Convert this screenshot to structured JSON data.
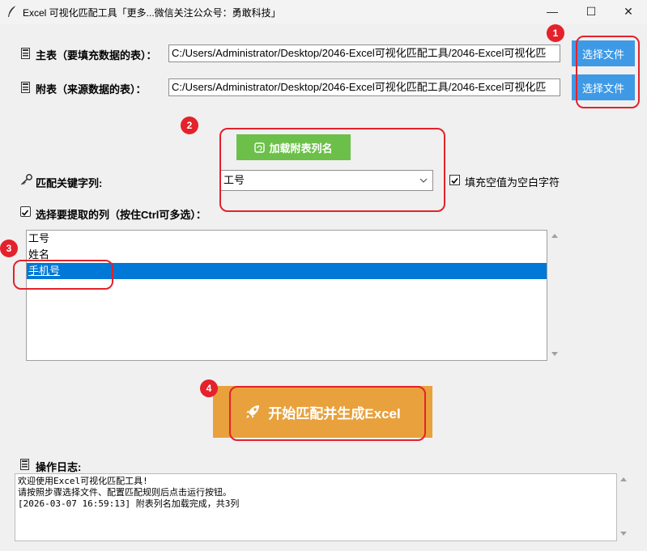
{
  "window": {
    "title": "Excel 可视化匹配工具「更多...微信关注公众号：勇敢科技」",
    "controls": {
      "minimize": "—",
      "maximize": "☐",
      "close": "✕"
    }
  },
  "main_table": {
    "label": "主表（要填充数据的表）：",
    "path": "C:/Users/Administrator/Desktop/2046-Excel可视化匹配工具/2046-Excel可视化匹",
    "button": "选择文件"
  },
  "sub_table": {
    "label": "附表（来源数据的表）：",
    "path": "C:/Users/Administrator/Desktop/2046-Excel可视化匹配工具/2046-Excel可视化匹",
    "button": "选择文件"
  },
  "load_button": {
    "label": "加载附表列名"
  },
  "key_column": {
    "label": "匹配关键字列:",
    "selected": "工号",
    "fill_blank_checkbox": {
      "label": "填充空值为空白字符",
      "checked": true
    }
  },
  "columns": {
    "label": "选择要提取的列（按住Ctrl可多选）：",
    "checked": true,
    "items": [
      {
        "text": "工号",
        "selected": false
      },
      {
        "text": "姓名",
        "selected": false
      },
      {
        "text": "手机号",
        "selected": true
      }
    ]
  },
  "start_button": {
    "label": "开始匹配并生成Excel"
  },
  "log": {
    "label": "操作日志:",
    "lines": [
      "欢迎使用Excel可视化匹配工具!",
      "请按照步骤选择文件、配置匹配规则后点击运行按钮。",
      "[2026-03-07 16:59:13] 附表列名加载完成，共3列"
    ]
  },
  "badges": [
    "1",
    "2",
    "3",
    "4"
  ],
  "colors": {
    "accent_blue": "#3f9ae6",
    "load_green": "#6cc04a",
    "start_orange": "#e8a13c",
    "annotation_red": "#e3222b",
    "selection_blue": "#0078d7"
  }
}
